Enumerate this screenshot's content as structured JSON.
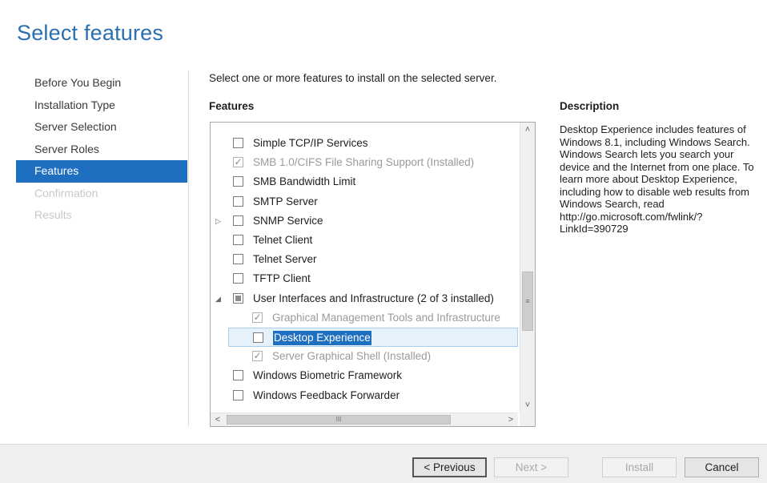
{
  "title": "Select features",
  "nav": [
    {
      "label": "Before You Begin",
      "state": "normal"
    },
    {
      "label": "Installation Type",
      "state": "normal"
    },
    {
      "label": "Server Selection",
      "state": "normal"
    },
    {
      "label": "Server Roles",
      "state": "normal"
    },
    {
      "label": "Features",
      "state": "active"
    },
    {
      "label": "Confirmation",
      "state": "disabled"
    },
    {
      "label": "Results",
      "state": "disabled"
    }
  ],
  "intro": "Select one or more features to install on the selected server.",
  "features_heading": "Features",
  "features": [
    {
      "label": "Simple TCP/IP Services",
      "check": "unchecked",
      "installed": false,
      "expander": ""
    },
    {
      "label": "SMB 1.0/CIFS File Sharing Support (Installed)",
      "check": "checked",
      "installed": true,
      "expander": ""
    },
    {
      "label": "SMB Bandwidth Limit",
      "check": "unchecked",
      "installed": false,
      "expander": ""
    },
    {
      "label": "SMTP Server",
      "check": "unchecked",
      "installed": false,
      "expander": ""
    },
    {
      "label": "SNMP Service",
      "check": "unchecked",
      "installed": false,
      "expander": "▷"
    },
    {
      "label": "Telnet Client",
      "check": "unchecked",
      "installed": false,
      "expander": ""
    },
    {
      "label": "Telnet Server",
      "check": "unchecked",
      "installed": false,
      "expander": ""
    },
    {
      "label": "TFTP Client",
      "check": "unchecked",
      "installed": false,
      "expander": ""
    },
    {
      "label": "User Interfaces and Infrastructure (2 of 3 installed)",
      "check": "partial",
      "installed": false,
      "expander": "◢"
    },
    {
      "label": "Graphical Management Tools and Infrastructure",
      "check": "checked",
      "installed": true,
      "expander": "",
      "indent": true
    },
    {
      "label": "Desktop Experience",
      "check": "unchecked",
      "installed": false,
      "expander": "",
      "indent": true,
      "selected": true
    },
    {
      "label": "Server Graphical Shell (Installed)",
      "check": "checked",
      "installed": true,
      "expander": "",
      "indent": true
    },
    {
      "label": "Windows Biometric Framework",
      "check": "unchecked",
      "installed": false,
      "expander": ""
    },
    {
      "label": "Windows Feedback Forwarder",
      "check": "unchecked",
      "installed": false,
      "expander": ""
    }
  ],
  "description_heading": "Description",
  "description": "Desktop Experience includes features of Windows 8.1, including Windows Search. Windows Search lets you search your device and the Internet from one place. To learn more about Desktop Experience, including how to disable web results from Windows Search, read http://go.microsoft.com/fwlink/?LinkId=390729",
  "footer": {
    "previous": "< Previous",
    "next": "Next >",
    "install": "Install",
    "cancel": "Cancel"
  },
  "icons": {
    "scroll_up": "˄",
    "scroll_down": "˅",
    "scroll_left": "<",
    "scroll_right": ">",
    "grip_v": "≡",
    "grip_h": "III",
    "check_mark": "✓"
  }
}
